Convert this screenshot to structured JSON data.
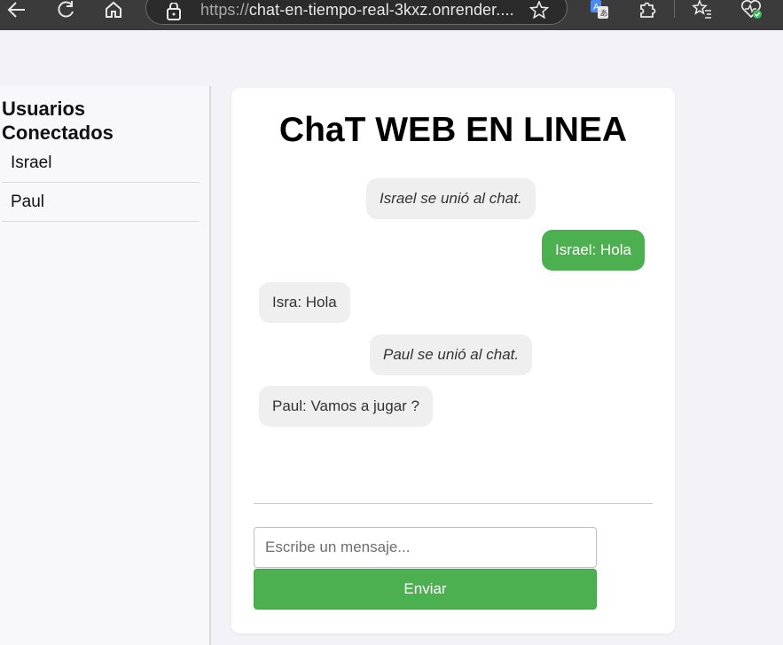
{
  "browser": {
    "url_protocol": "https://",
    "url_rest": "chat-en-tiempo-real-3kxz.onrender...."
  },
  "sidebar": {
    "title": "Usuarios Conectados",
    "users": [
      "Israel",
      "Paul"
    ]
  },
  "chat": {
    "title": "ChaT WEB EN LINEA",
    "messages": [
      {
        "text": "Israel se unió al chat.",
        "kind": "system"
      },
      {
        "text": "Israel: Hola",
        "kind": "own"
      },
      {
        "text": "Isra: Hola",
        "kind": "other"
      },
      {
        "text": "Paul se unió al chat.",
        "kind": "system"
      },
      {
        "text": "Paul: Vamos a jugar ?",
        "kind": "other"
      }
    ],
    "input_placeholder": "Escribe un mensaje...",
    "send_label": "Enviar"
  },
  "colors": {
    "accent": "#4caf50",
    "chrome": "#3b3b3b"
  }
}
